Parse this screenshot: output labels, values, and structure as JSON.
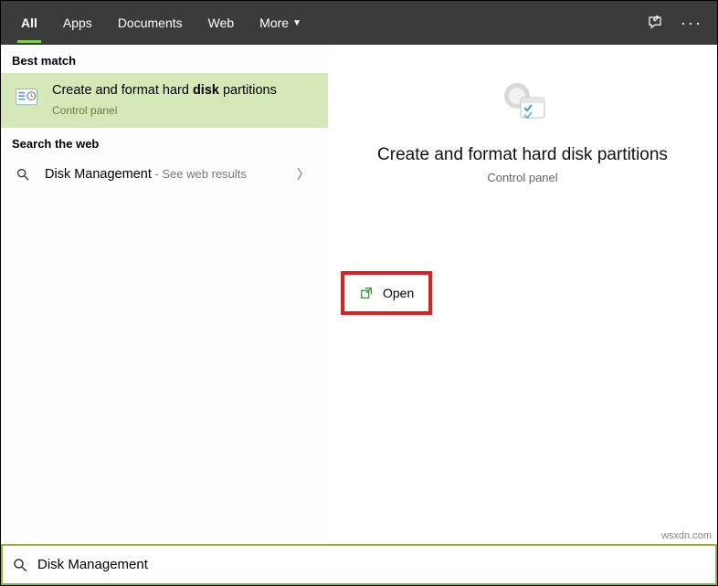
{
  "tabs": {
    "all": "All",
    "apps": "Apps",
    "documents": "Documents",
    "web": "Web",
    "more": "More"
  },
  "sections": {
    "best_match": "Best match",
    "search_web": "Search the web"
  },
  "best_match": {
    "title_pre": "Create and format hard ",
    "title_bold": "disk",
    "title_post": " partitions",
    "subtitle": "Control panel"
  },
  "web_result": {
    "label": "Disk Management",
    "hint": " - See web results"
  },
  "preview": {
    "title": "Create and format hard disk partitions",
    "subtitle": "Control panel"
  },
  "actions": {
    "open": "Open"
  },
  "search": {
    "value": "Disk Management"
  },
  "watermark": "wsxdn.com"
}
